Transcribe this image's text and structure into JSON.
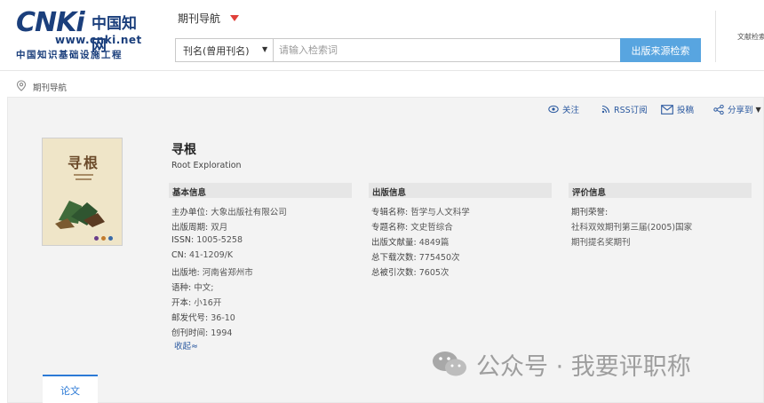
{
  "header": {
    "logo": {
      "brand": "CNKi",
      "cn": "中国知网",
      "url": "www.cnki.net",
      "subtitle": "中国知识基础设施工程"
    },
    "nav_title": "期刊导航",
    "search": {
      "field_select": "刊名(曾用刊名)",
      "placeholder": "请输入检索词",
      "button_label": "出版来源检索"
    },
    "right_link": "文献检索"
  },
  "breadcrumb": {
    "label": "期刊导航"
  },
  "toolbar": {
    "follow": "关注",
    "rss": "RSS订阅",
    "submit": "投稿",
    "share": "分享到"
  },
  "journal": {
    "cover_title": "寻根",
    "name": "寻根",
    "name_en": "Root Exploration"
  },
  "basic_info": {
    "heading": "基本信息",
    "items": [
      {
        "key": "主办单位:",
        "value": "大象出版社有限公司"
      },
      {
        "key": "出版周期:",
        "value": "双月"
      },
      {
        "key": "ISSN:",
        "value": "1005-5258"
      },
      {
        "key": "CN:",
        "value": "41-1209/K"
      },
      {
        "key": "出版地:",
        "value": "河南省郑州市"
      },
      {
        "key": "语种:",
        "value": "中文;"
      },
      {
        "key": "开本:",
        "value": "小16开"
      },
      {
        "key": "邮发代号:",
        "value": "36-10"
      },
      {
        "key": "创刊时间:",
        "value": "1994"
      }
    ],
    "collapse_label": "收起≈"
  },
  "publish_info": {
    "heading": "出版信息",
    "items": [
      {
        "key": "专辑名称:",
        "value": "哲学与人文科学"
      },
      {
        "key": "专题名称:",
        "value": "文史哲综合"
      },
      {
        "key": "出版文献量:",
        "value": "4849篇"
      },
      {
        "key": "总下载次数:",
        "value": "775450次"
      },
      {
        "key": "总被引次数:",
        "value": "7605次"
      }
    ]
  },
  "evaluation_info": {
    "heading": "评价信息",
    "honor_label": "期刊荣誉:",
    "honors": [
      "社科双效期刊第三届(2005)国家",
      "期刊提名奖期刊"
    ]
  },
  "tabs": {
    "papers": "论文"
  },
  "watermark": {
    "text": "公众号 · 我要评职称"
  },
  "colors": {
    "link_blue": "#2c5aa0",
    "search_button": "#58a5e0",
    "caret_red": "#e0403a",
    "panel_bg": "#f3f3f3",
    "tab_accent": "#2c7ad6"
  }
}
